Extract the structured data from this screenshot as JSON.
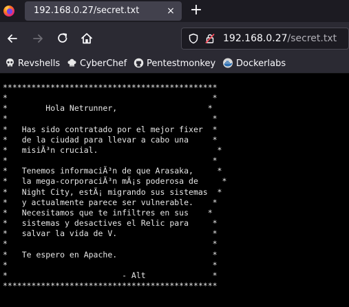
{
  "tab": {
    "title": "192.168.0.27/secret.txt",
    "close_icon": "×",
    "new_tab_icon": "+"
  },
  "url": {
    "host": "192.168.0.27",
    "path": "/secret.txt"
  },
  "bookmarks": [
    {
      "label": "Revshells",
      "icon": "skull-icon"
    },
    {
      "label": "CyberChef",
      "icon": "chef-hat-icon"
    },
    {
      "label": "Pentestmonkey",
      "icon": "github-icon"
    },
    {
      "label": "Dockerlabs",
      "icon": "docker-icon"
    }
  ],
  "document": {
    "text": "*********************************************\n*                                           *\n*        Hola Netrunner,                   *\n*                                           *\n*   Has sido contratado por el mejor fixer  *\n*   de la ciudad para llevar a cabo una     *\n*   misiÃ³n crucial.                         *\n*                                           *\n*   Tenemos informaciÃ³n de que Arasaka,     *\n*   la mega-corporaciÃ³n mÃ¡s poderosa de     *\n*   Night City, estÃ¡ migrando sus sistemas  *\n*   y actualmente parece ser vulnerable.    *\n*   Necesitamos que te infiltres en sus    *\n*   sistemas y desactives el Relic para     *\n*   salvar la vida de V.                    *\n*                                           *\n*   Te espero en Apache.                    *\n*                                           *\n*                        - Alt              *\n*********************************************"
  }
}
